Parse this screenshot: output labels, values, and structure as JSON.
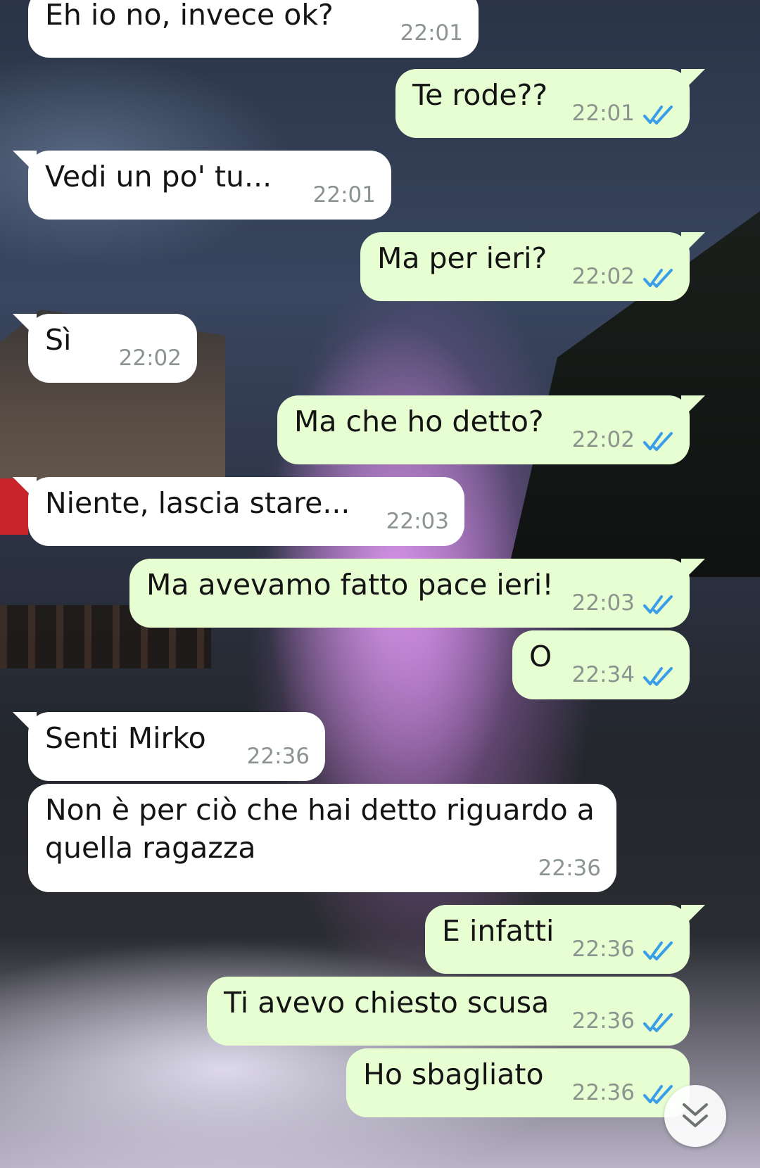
{
  "messages": [
    {
      "direction": "in",
      "text": "Eh io no, invece ok?",
      "time": "22:01"
    },
    {
      "direction": "out",
      "text": "Te rode??",
      "time": "22:01",
      "status": "read"
    },
    {
      "direction": "in",
      "text": "Vedi un po' tu...",
      "time": "22:01"
    },
    {
      "direction": "out",
      "text": "Ma per ieri?",
      "time": "22:02",
      "status": "read"
    },
    {
      "direction": "in",
      "text": "Sì",
      "time": "22:02"
    },
    {
      "direction": "out",
      "text": "Ma che ho detto?",
      "time": "22:02",
      "status": "read"
    },
    {
      "direction": "in",
      "text": "Niente, lascia stare...",
      "time": "22:03"
    },
    {
      "direction": "out",
      "text": "Ma avevamo fatto pace ieri!",
      "time": "22:03",
      "status": "read"
    },
    {
      "direction": "out",
      "text": "O",
      "time": "22:34",
      "status": "read"
    },
    {
      "direction": "in",
      "text": "Senti Mirko",
      "time": "22:36"
    },
    {
      "direction": "in",
      "text": "Non è per ciò che hai detto riguardo a quella ragazza",
      "time": "22:36"
    },
    {
      "direction": "out",
      "text": "E infatti",
      "time": "22:36",
      "status": "read"
    },
    {
      "direction": "out",
      "text": "Ti avevo chiesto scusa",
      "time": "22:36",
      "status": "read"
    },
    {
      "direction": "out",
      "text": "Ho sbagliato",
      "time": "22:36",
      "status": "read"
    }
  ],
  "colors": {
    "incoming_bubble": "#ffffff",
    "outgoing_bubble": "#e7fed3",
    "read_ticks": "#3a9ee6",
    "timestamp": "#8c948f"
  },
  "icons": {
    "read_receipt": "double-check-icon",
    "scroll_down": "chevron-double-down-icon"
  }
}
